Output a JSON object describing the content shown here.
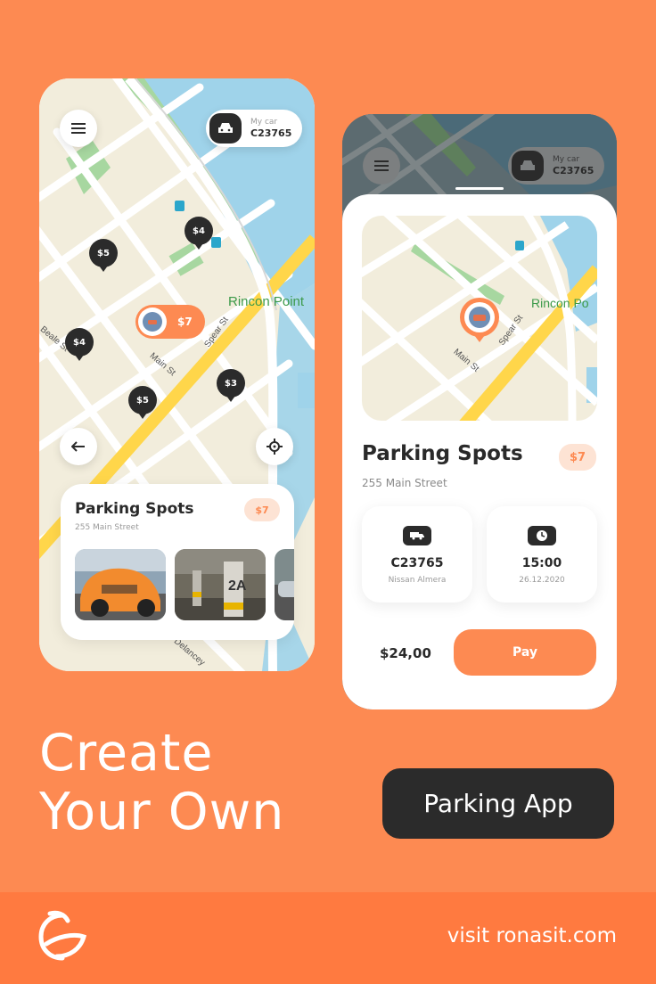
{
  "colors": {
    "accent": "#FD8A52",
    "dark": "#2B2B2B",
    "badge_bg": "#FDE3D4",
    "footer": "#FF7A40"
  },
  "screen1": {
    "menu_icon": "hamburger-icon",
    "car": {
      "label": "My car",
      "plate": "C23765"
    },
    "map_labels": {
      "place": "Rincon Point",
      "street1": "Spear St",
      "street2": "Main St",
      "street3": "Beale St",
      "street4": "Delancey"
    },
    "pins": [
      "$5",
      "$4",
      "$4",
      "$5",
      "$3"
    ],
    "active_pin_price": "$7",
    "card": {
      "title": "Parking Spots",
      "address": "255 Main Street",
      "price": "$7"
    }
  },
  "screen2": {
    "menu_icon": "hamburger-icon",
    "car": {
      "label": "My car",
      "plate": "C23765"
    },
    "map_labels": {
      "place": "Rincon Po",
      "street1": "Spear St",
      "street2": "Main St"
    },
    "title": "Parking Spots",
    "address": "255 Main Street",
    "price": "$7",
    "vehicle": {
      "plate": "C23765",
      "model": "Nissan Almera"
    },
    "time": {
      "value": "15:00",
      "date": "26.12.2020"
    },
    "total": "$24,00",
    "pay_label": "Pay"
  },
  "headline": {
    "line1": "Create",
    "line2": "Your Own"
  },
  "cta_label": "Parking App",
  "footer_url": "visit ronasit.com"
}
